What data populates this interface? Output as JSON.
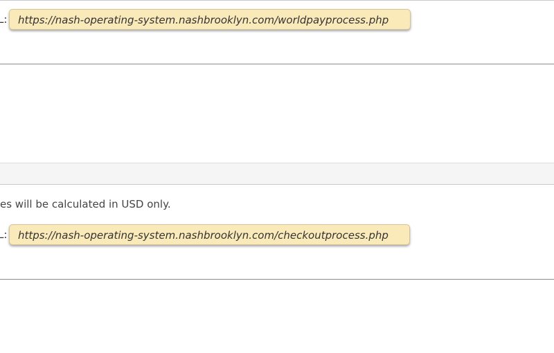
{
  "section_one": {
    "label_fragment": "L:",
    "url": "https://nash-operating-system.nashbrooklyn.com/worldpayprocess.php"
  },
  "section_two": {
    "note": "es will be calculated in USD only.",
    "label_fragment": "L:",
    "url": "https://nash-operating-system.nashbrooklyn.com/checkoutprocess.php"
  }
}
